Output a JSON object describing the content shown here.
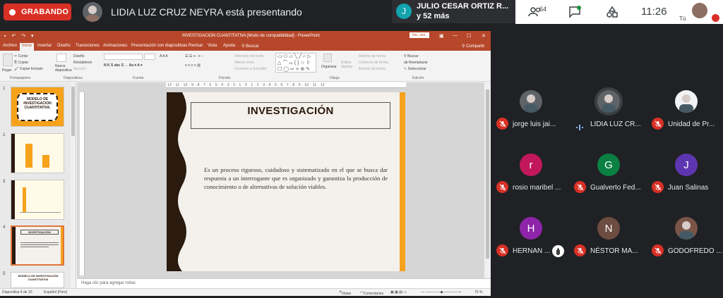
{
  "meet": {
    "recording_label": "GRABANDO",
    "presenter_text": "LIDIA LUZ CRUZ NEYRA está presentando",
    "notification": {
      "avatar_letter": "J",
      "line1": "JULIO CESAR ORTIZ R...",
      "line2": "y 52 más"
    },
    "participant_count": "64",
    "clock": "11:26",
    "self_label": "Tú"
  },
  "colors": {
    "meet_bg": "#202124",
    "ppt_accent": "#b7472a",
    "slide_orange": "#f6a21b",
    "slide_brown": "#2b1a0e",
    "recording": "#d93025"
  },
  "powerpoint": {
    "title": "INVESTIGACION CUANTITATIVA [Modo de compatibilidad] - PowerPoint",
    "signin": "Inic. ses.",
    "tabs": [
      "Archivo",
      "Inicio",
      "Insertar",
      "Diseño",
      "Transiciones",
      "Animaciones",
      "Presentación con diapositivas",
      "Revisar",
      "Vista",
      "Ayuda",
      "Buscar"
    ],
    "share": "Compartir",
    "ribbon": {
      "paste": "Pegar",
      "cut": "Cortar",
      "copy": "Copiar",
      "format_painter": "Copiar formato",
      "new_slide": "Nueva diapositiva",
      "layout": "Diseño",
      "reset": "Restablecer",
      "section": "Sección",
      "text_direction": "Dirección del texto",
      "align_text": "Alinear texto",
      "smartart": "Convertir a SmartArt",
      "arrange": "Organizar",
      "quick_styles": "Estilos rápidos",
      "shape_fill": "Relleno de forma",
      "shape_outline": "Contorno de forma",
      "shape_effects": "Efectos de forma",
      "find": "Buscar",
      "replace": "Reemplazar",
      "select": "Seleccionar",
      "groups": [
        "Portapapeles",
        "Diapositivas",
        "Fuente",
        "Párrafo",
        "Dibujo",
        "Edición"
      ]
    },
    "thumbnails": [
      {
        "num": "1",
        "text": "MODELO DE INVESTIGACION CUANTITATIVA."
      },
      {
        "num": "2",
        "text": ""
      },
      {
        "num": "3",
        "text": ""
      },
      {
        "num": "4",
        "text": "INVESTIGACIÓN"
      },
      {
        "num": "5",
        "text": "MODELO DE INVESTIGACIÓN CUANTITATIVA"
      }
    ],
    "slide": {
      "title": "INVESTIGACIÓN",
      "body": "Es un proceso riguroso, cuidadoso y sistematizado en el que se busca dar respuesta a un interrogante que es organizado y garantiza la producción de conocimiento o de alternativas de solución viables."
    },
    "ruler_text": "12 · 11 · 10 · 9 · 8 · 7 · 6 · 5 · 4 · 3 · 2 · 1 · 0 · 1 · 2 · 3 · 4 · 5 · 6 · 7 · 8 · 9 · 10 · 11 · 12",
    "notes_placeholder": "Haga clic para agregar notas",
    "status": {
      "slide_info": "Diapositiva 4 de 10",
      "language": "Español (Perú)",
      "notes": "Notas",
      "comments": "Comentarios",
      "zoom": "76 %"
    }
  },
  "participants": [
    {
      "name": "jorge luis jai...",
      "avatar_letter": "",
      "avatar_color": "#5f6368",
      "muted": true,
      "hand": false,
      "speaking": false
    },
    {
      "name": "LIDIA LUZ CR...",
      "avatar_letter": "",
      "avatar_color": "#5f6368",
      "muted": false,
      "hand": false,
      "speaking": true
    },
    {
      "name": "Unidad de Pr...",
      "avatar_letter": "",
      "avatar_color": "#f1f3f4",
      "muted": true,
      "hand": false,
      "speaking": false
    },
    {
      "name": "rosio maribel ...",
      "avatar_letter": "r",
      "avatar_color": "#c2185b",
      "muted": true,
      "hand": false,
      "speaking": false
    },
    {
      "name": "Gualverto Fed...",
      "avatar_letter": "G",
      "avatar_color": "#0b8043",
      "muted": true,
      "hand": false,
      "speaking": false
    },
    {
      "name": "Juan Salinas",
      "avatar_letter": "J",
      "avatar_color": "#5e35b1",
      "muted": true,
      "hand": false,
      "speaking": false
    },
    {
      "name": "HERNAN ...",
      "avatar_letter": "H",
      "avatar_color": "#8e24aa",
      "muted": true,
      "hand": true,
      "speaking": false
    },
    {
      "name": "NÉSTOR MA...",
      "avatar_letter": "N",
      "avatar_color": "#6d4c41",
      "muted": true,
      "hand": false,
      "speaking": false
    },
    {
      "name": "GODOFREDO ...",
      "avatar_letter": "",
      "avatar_color": "#795548",
      "muted": true,
      "hand": false,
      "speaking": false
    }
  ]
}
